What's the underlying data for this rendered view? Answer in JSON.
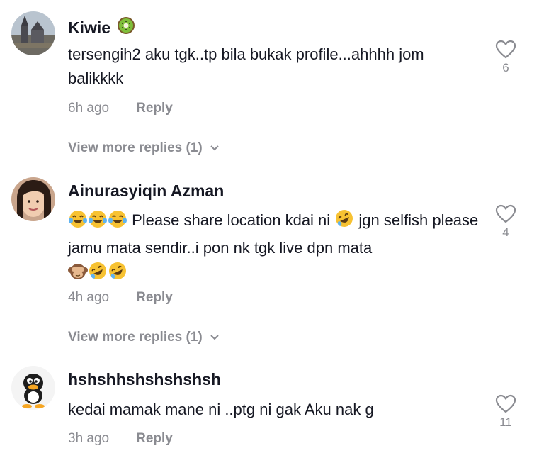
{
  "comments": [
    {
      "username": "Kiwie",
      "username_emoji": "kiwi-fruit-emoji",
      "text": "tersengih2 aku tgk..tp bila bukak profile...ahhhh jom balikkkk",
      "time": "6h ago",
      "reply_label": "Reply",
      "likes": "6",
      "view_more": "View more replies (1)"
    },
    {
      "username": "Ainurasyiqin Azman",
      "text_prefix_emojis": [
        "tears-of-joy-emoji",
        "tears-of-joy-emoji",
        "tears-of-joy-emoji"
      ],
      "text_part1": " Please share location kdai ni ",
      "text_mid_emoji": "rolling-laughing-emoji",
      "text_part2": " jgn selfish please jamu mata sendir..i pon nk tgk live dpn mata",
      "text_suffix_emojis": [
        "see-no-evil-monkey-emoji",
        "rolling-laughing-emoji",
        "rolling-laughing-emoji"
      ],
      "time": "4h ago",
      "reply_label": "Reply",
      "likes": "4",
      "view_more": "View more replies (1)"
    },
    {
      "username": "hshshhshshshshsh",
      "text": "kedai mamak mane ni ..ptg ni gak Aku nak g",
      "time": "3h ago",
      "reply_label": "Reply",
      "likes": "11"
    }
  ],
  "colors": {
    "primary_text": "#161823",
    "secondary_text": "#8a8b91",
    "emoji_yellow": "#f7c232"
  }
}
